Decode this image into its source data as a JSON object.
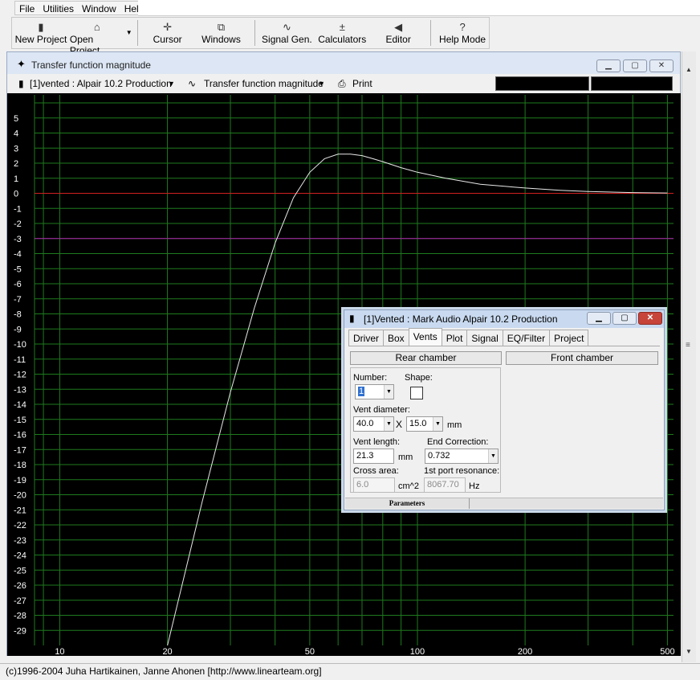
{
  "menu": [
    "File",
    "Utilities",
    "Window",
    "Help"
  ],
  "toolbar": {
    "new_project": "New Project",
    "open_project": "Open Project",
    "cursor": "Cursor",
    "windows": "Windows",
    "signal_gen": "Signal Gen.",
    "calculators": "Calculators",
    "editor": "Editor",
    "help_mode": "Help Mode"
  },
  "graph_window": {
    "title": "Transfer function magnitude",
    "project_select": "[1]vented : Alpair 10.2 Production",
    "view_select": "Transfer function magnitude",
    "print_label": "Print"
  },
  "chart_data": {
    "type": "line",
    "x_scale": "log",
    "xlim": [
      8.5,
      520
    ],
    "ylim": [
      -30,
      6
    ],
    "x_ticks": [
      "10",
      "20",
      "50",
      "100",
      "200",
      "500"
    ],
    "y_ticks": [
      "5",
      "4",
      "3",
      "2",
      "1",
      "0",
      "-1",
      "-2",
      "-3",
      "-4",
      "-5",
      "-6",
      "-7",
      "-8",
      "-9",
      "-10",
      "-11",
      "-12",
      "-13",
      "-14",
      "-15",
      "-16",
      "-17",
      "-18",
      "-19",
      "-20",
      "-21",
      "-22",
      "-23",
      "-24",
      "-25",
      "-26",
      "-27",
      "-28",
      "-29"
    ],
    "reference_lines": [
      {
        "y": 0,
        "color": "#d02020"
      },
      {
        "y": -3,
        "color": "#b020b0"
      }
    ],
    "series": [
      {
        "color": "#e8e8e8",
        "x": [
          20,
          25,
          30,
          35,
          40,
          45,
          50,
          55,
          60,
          65,
          70,
          75,
          80,
          90,
          100,
          120,
          150,
          200,
          250,
          300,
          400,
          500
        ],
        "y": [
          -30,
          -20.5,
          -13.2,
          -7.6,
          -3.3,
          -0.3,
          1.4,
          2.3,
          2.6,
          2.6,
          2.5,
          2.3,
          2.1,
          1.7,
          1.4,
          1.0,
          0.6,
          0.35,
          0.2,
          0.12,
          0.05,
          0.02
        ]
      }
    ],
    "grid": true,
    "grid_color": "#1e7a1e"
  },
  "dialog": {
    "title": "[1]Vented : Mark Audio Alpair 10.2 Production",
    "tabs": [
      "Driver",
      "Box",
      "Vents",
      "Plot",
      "Signal",
      "EQ/Filter",
      "Project"
    ],
    "active_tab": "Vents",
    "rear_chamber": "Rear chamber",
    "front_chamber": "Front chamber",
    "number_label": "Number:",
    "number_value": "1",
    "shape_label": "Shape:",
    "vent_diameter_label": "Vent diameter:",
    "vent_d1": "40.0",
    "x_sep": "X",
    "vent_d2": "15.0",
    "mm1": "mm",
    "vent_length_label": "Vent length:",
    "vent_length": "21.3",
    "mm2": "mm",
    "end_correction_label": "End Correction:",
    "end_correction": "0.732",
    "cross_area_label": "Cross area:",
    "cross_area": "6.0",
    "cm2": "cm^2",
    "port_res_label": "1st port resonance:",
    "port_res": "8067.70",
    "hz": "Hz",
    "status_panel": "Parameters"
  },
  "status": "(c)1996-2004 Juha Hartikainen, Janne Ahonen [http://www.linearteam.org]"
}
